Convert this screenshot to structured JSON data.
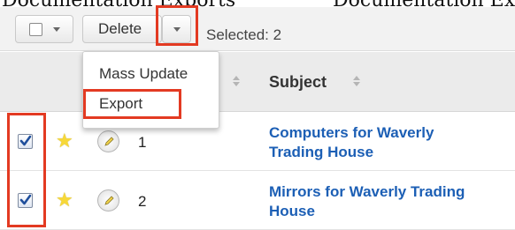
{
  "cropped_top_text": {
    "left": "Documentation Exports",
    "right": "Documentation Export"
  },
  "toolbar": {
    "select_all_caret": "chevron-down-icon",
    "delete_label": "Delete",
    "actions_caret": "chevron-down-icon",
    "selected_text": "Selected: 2"
  },
  "dropdown": {
    "items": [
      {
        "label": "Mass Update"
      },
      {
        "label": "Export"
      }
    ]
  },
  "table": {
    "columns": [
      {
        "label": "",
        "sortable": true
      },
      {
        "label": "Subject",
        "sortable": true
      }
    ],
    "rows": [
      {
        "checked": true,
        "favorite": true,
        "num": "1",
        "subject_line1": "Computers for Waverly",
        "subject_line2": "Trading House"
      },
      {
        "checked": true,
        "favorite": true,
        "num": "2",
        "subject_line1": "Mirrors for Waverly Trading",
        "subject_line2": "House"
      }
    ]
  },
  "colors": {
    "highlight": "#e33a22",
    "link": "#1c5fb5",
    "star": "#f7d838"
  }
}
